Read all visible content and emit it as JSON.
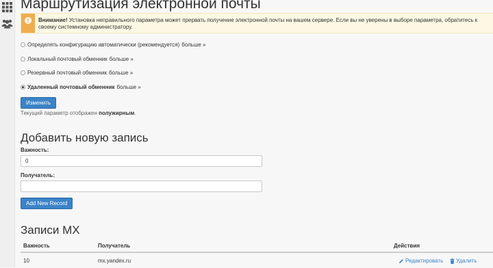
{
  "colors": {
    "accent": "#3a83c7",
    "warning_bg": "#fcf8e3",
    "warning_icon_bg": "#f0ad4e"
  },
  "sidebar": {
    "icons": [
      "grid-icon",
      "users-icon"
    ]
  },
  "page": {
    "title": "Маршрутизация электронной почты"
  },
  "warning": {
    "strong": "Внимание!",
    "text": " Установка неправильного параметра может прервать получение электронной почты на вашем сервере. Если вы не уверены в выборе параметра, обратитесь к своему системному администратору."
  },
  "routing_options": [
    {
      "label": "Определять конфигурацию автоматически (рекомендуется)",
      "more": "больше »",
      "selected": false
    },
    {
      "label": "Локальный почтовый обменник",
      "more": "больше »",
      "selected": false
    },
    {
      "label": "Резервный почтовый обменник",
      "more": "больше »",
      "selected": false
    },
    {
      "label": "Удаленный почтовый обменник",
      "more": "больше »",
      "selected": true
    }
  ],
  "change_button": "Изменить",
  "hint": {
    "prefix": "Текущий параметр отображен ",
    "bold": "полужирным",
    "suffix": "."
  },
  "add_record": {
    "title": "Добавить новую запись",
    "priority_label": "Важность:",
    "priority_value": "0",
    "destination_label": "Получатель:",
    "destination_value": "",
    "button": "Add New Record"
  },
  "mx_records": {
    "title": "Записи MX",
    "columns": {
      "priority": "Важность",
      "destination": "Получатель",
      "actions": "Действия"
    },
    "rows": [
      {
        "priority": "10",
        "destination": "mx.yandex.ru",
        "edit": "Редактировать",
        "delete": "Удалить"
      }
    ]
  }
}
